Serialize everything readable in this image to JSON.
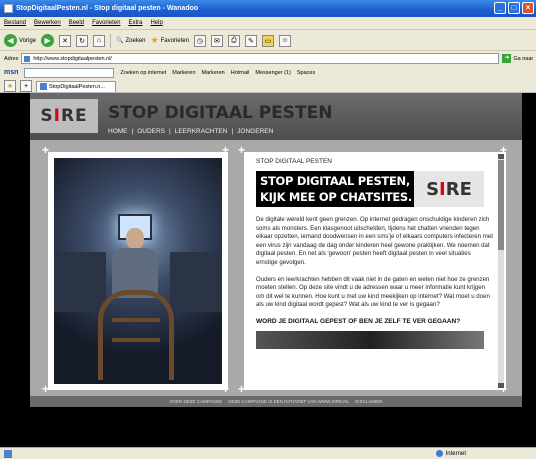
{
  "window": {
    "title": "StopDigitaalPesten.nl - Stop digitaal pesten - Wanadoo"
  },
  "menu": [
    "Bestand",
    "Bewerken",
    "Beeld",
    "Favorieten",
    "Extra",
    "Help"
  ],
  "toolbar": {
    "back_label": "Vorige",
    "search_label": "Zoeken",
    "favorites_label": "Favorieten"
  },
  "address": {
    "label": "Adres",
    "url": "http://www.stopdigitaalpesten.nl/",
    "go_label": "Ga naar"
  },
  "msn_bar": {
    "logo": "msn",
    "search_web": "Zoeken op internet",
    "highlight": "Markeren",
    "mark": "Markeren",
    "hotmail": "Hotmail",
    "messenger": "Messenger (1)",
    "spaces": "Spaces"
  },
  "tab": {
    "label": "StopDigitaalPesten.n..."
  },
  "site": {
    "logo_text_left": "S",
    "logo_text_red": "I",
    "logo_text_right": "RE",
    "title": "STOP DIGITAAL PESTEN",
    "nav": [
      "HOME",
      "|",
      "OUDERS",
      "|",
      "LEERKRACHTEN",
      "|",
      "JONGEREN"
    ],
    "kicker": "STOP DIGITAAL PESTEN",
    "banner_line1": "STOP DIGITAAL PESTEN,",
    "banner_line2": "KIJK MEE OP CHATSITES.",
    "para1": "De digitale wereld kent geen grenzen. Op internet gedragen onschuldige kinderen zich soms als monsters. Een klasgenoot uitschelden, tijdens het chatten vrienden tegen elkaar opzetten, iemand doodwensen in een sms'je of elkaars computers infecteren met een virus zijn vandaag de dag onder kinderen heel gewone praktijken. We noemen dat digitaal pesten. En net als 'gewoon' pesten heeft digitaal pesten in veel situaties ernstige gevolgen.",
    "para2": "Ouders en leerkrachten hebben dit vaak niet in de gaten en weten niet hoe ze grenzen moeten stellen. Op deze site vindt u de adressen waar u meer informatie kunt krijgen om dit wel te kunnen. Hoe kunt u met uw kind meekijken op internet? Wat moet u doen als uw kind digitaal wordt gepest? Wat als uw kind te ver is gegaan?",
    "subhead": "WORD JE DIGITAAL GEPEST OF BEN JE ZELF TE VER GEGAAN?",
    "footer": [
      "OVER DEZE CAMPAGNE",
      "DEZE CAMPAGNE IS EEN INITIATIEF VAN WWW.SIRE.NL",
      "DISCLAIMER"
    ]
  },
  "status": {
    "left": "",
    "zone": "Internet"
  }
}
